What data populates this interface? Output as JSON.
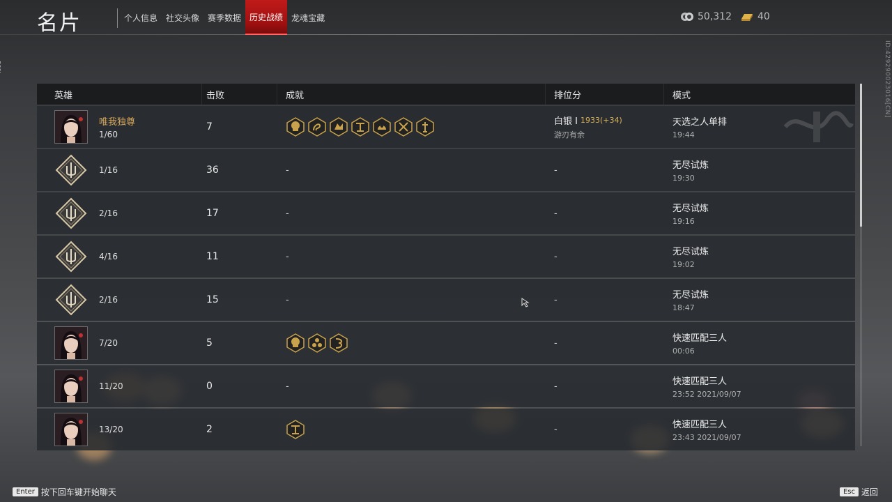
{
  "header": {
    "title": "名片",
    "tabs": [
      {
        "label": "个人信息",
        "active": false
      },
      {
        "label": "社交头像",
        "active": false
      },
      {
        "label": "赛季数据",
        "active": false
      },
      {
        "label": "历史战绩",
        "active": true
      },
      {
        "label": "龙魂宝藏",
        "active": false
      }
    ],
    "currency": [
      {
        "icon": "coins-icon",
        "value": "50,312"
      },
      {
        "icon": "gold-ingot-icon",
        "value": "40"
      }
    ]
  },
  "side_id": "ID:429290023016[CN]",
  "table": {
    "columns": [
      "英雄",
      "击败",
      "成就",
      "排位分",
      "模式"
    ],
    "rows": [
      {
        "hero": "portrait",
        "hero_name": "唯我独尊",
        "place": "1/60",
        "kills": "7",
        "achievements": 7,
        "rank_tier": "白银 Ⅰ",
        "rank_score": "1933(+34)",
        "rank_sub": "游刃有余",
        "mode": "天选之人单排",
        "time": "19:44"
      },
      {
        "hero": "emblem",
        "hero_name": "",
        "place": "1/16",
        "kills": "36",
        "achievements": 0,
        "ach_text": "-",
        "rank_text": "-",
        "mode": "无尽试炼",
        "time": "19:30"
      },
      {
        "hero": "emblem",
        "hero_name": "",
        "place": "2/16",
        "kills": "17",
        "achievements": 0,
        "ach_text": "-",
        "rank_text": "-",
        "mode": "无尽试炼",
        "time": "19:16"
      },
      {
        "hero": "emblem",
        "hero_name": "",
        "place": "4/16",
        "kills": "11",
        "achievements": 0,
        "ach_text": "-",
        "rank_text": "-",
        "mode": "无尽试炼",
        "time": "19:02"
      },
      {
        "hero": "emblem",
        "hero_name": "",
        "place": "2/16",
        "kills": "15",
        "achievements": 0,
        "ach_text": "-",
        "rank_text": "-",
        "mode": "无尽试炼",
        "time": "18:47"
      },
      {
        "hero": "portrait",
        "hero_name": "",
        "place": "7/20",
        "kills": "5",
        "achievements": 3,
        "rank_text": "-",
        "mode": "快速匹配三人",
        "time": "00:06"
      },
      {
        "hero": "portrait",
        "hero_name": "",
        "place": "11/20",
        "kills": "0",
        "achievements": 0,
        "ach_text": "-",
        "rank_text": "-",
        "mode": "快速匹配三人",
        "time": "23:52  2021/09/07"
      },
      {
        "hero": "portrait",
        "hero_name": "",
        "place": "13/20",
        "kills": "2",
        "achievements": 1,
        "rank_text": "-",
        "mode": "快速匹配三人",
        "time": "23:43  2021/09/07"
      }
    ]
  },
  "footer": {
    "enter_key": "Enter",
    "enter_hint": "按下回车键开始聊天",
    "esc_key": "Esc",
    "esc_hint": "返回"
  },
  "colors": {
    "accent_tab": "#c01a1a",
    "gold": "#d6a85c"
  }
}
